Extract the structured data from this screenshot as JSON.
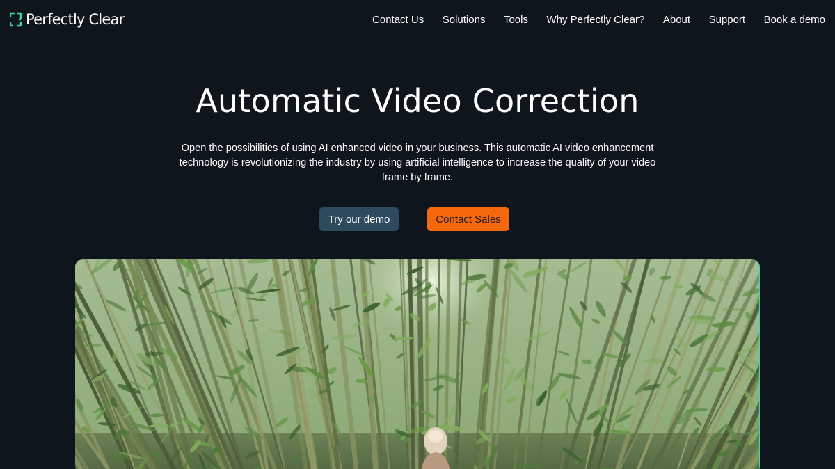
{
  "header": {
    "logo_text": "Perfectly Clear",
    "nav": [
      {
        "label": "Contact Us"
      },
      {
        "label": "Solutions"
      },
      {
        "label": "Tools"
      },
      {
        "label": "Why Perfectly Clear?"
      },
      {
        "label": "About"
      },
      {
        "label": "Support"
      },
      {
        "label": "Book a demo"
      }
    ]
  },
  "hero": {
    "title": "Automatic Video Correction",
    "description": "Open the possibilities of using AI enhanced video in your business. This automatic AI video enhancement technology is revolutionizing the industry by using artificial intelligence to increase the quality of your video frame by frame.",
    "demo_button": "Try our demo",
    "sales_button": "Contact Sales"
  },
  "colors": {
    "background": "#0f151d",
    "logo_accent": "#3fd8a8",
    "demo_button": "#2d4a5f",
    "sales_button": "#f5690c"
  }
}
